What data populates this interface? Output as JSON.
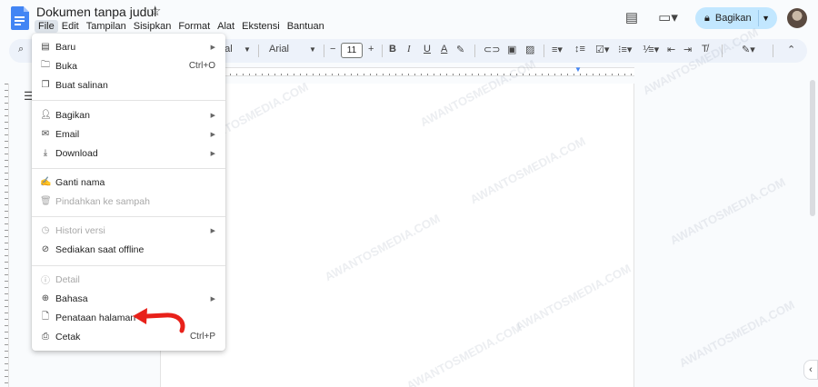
{
  "document": {
    "title": "Dokumen tanpa judul"
  },
  "menubar": [
    "File",
    "Edit",
    "Tampilan",
    "Sisipkan",
    "Format",
    "Alat",
    "Ekstensi",
    "Bantuan"
  ],
  "share": {
    "label": "Bagikan"
  },
  "toolbar": {
    "style_partial": "mal",
    "font": "Arial",
    "font_size": "11"
  },
  "file_menu": {
    "items": [
      {
        "label": "Baru",
        "icon": "new-doc-icon",
        "submenu": true
      },
      {
        "label": "Buka",
        "icon": "folder-icon",
        "shortcut": "Ctrl+O"
      },
      {
        "label": "Buat salinan",
        "icon": "copy-icon"
      },
      {
        "label": "Bagikan",
        "icon": "share-person-icon",
        "submenu": true
      },
      {
        "label": "Email",
        "icon": "email-icon",
        "submenu": true
      },
      {
        "label": "Download",
        "icon": "download-icon",
        "submenu": true
      },
      {
        "label": "Ganti nama",
        "icon": "rename-icon"
      },
      {
        "label": "Pindahkan ke sampah",
        "icon": "trash-icon",
        "disabled": true
      },
      {
        "label": "Histori versi",
        "icon": "history-icon",
        "submenu": true,
        "disabled": true
      },
      {
        "label": "Sediakan saat offline",
        "icon": "offline-icon"
      },
      {
        "label": "Detail",
        "icon": "info-icon",
        "disabled": true
      },
      {
        "label": "Bahasa",
        "icon": "globe-icon",
        "submenu": true
      },
      {
        "label": "Penataan halaman",
        "icon": "page-setup-icon"
      },
      {
        "label": "Cetak",
        "icon": "print-icon",
        "shortcut": "Ctrl+P"
      }
    ]
  },
  "watermark": "AWANTOSMEDIA.COM",
  "colors": {
    "accent": "#c2e7ff",
    "doc_blue": "#4285f4",
    "annotation_arrow": "#e8211a"
  }
}
